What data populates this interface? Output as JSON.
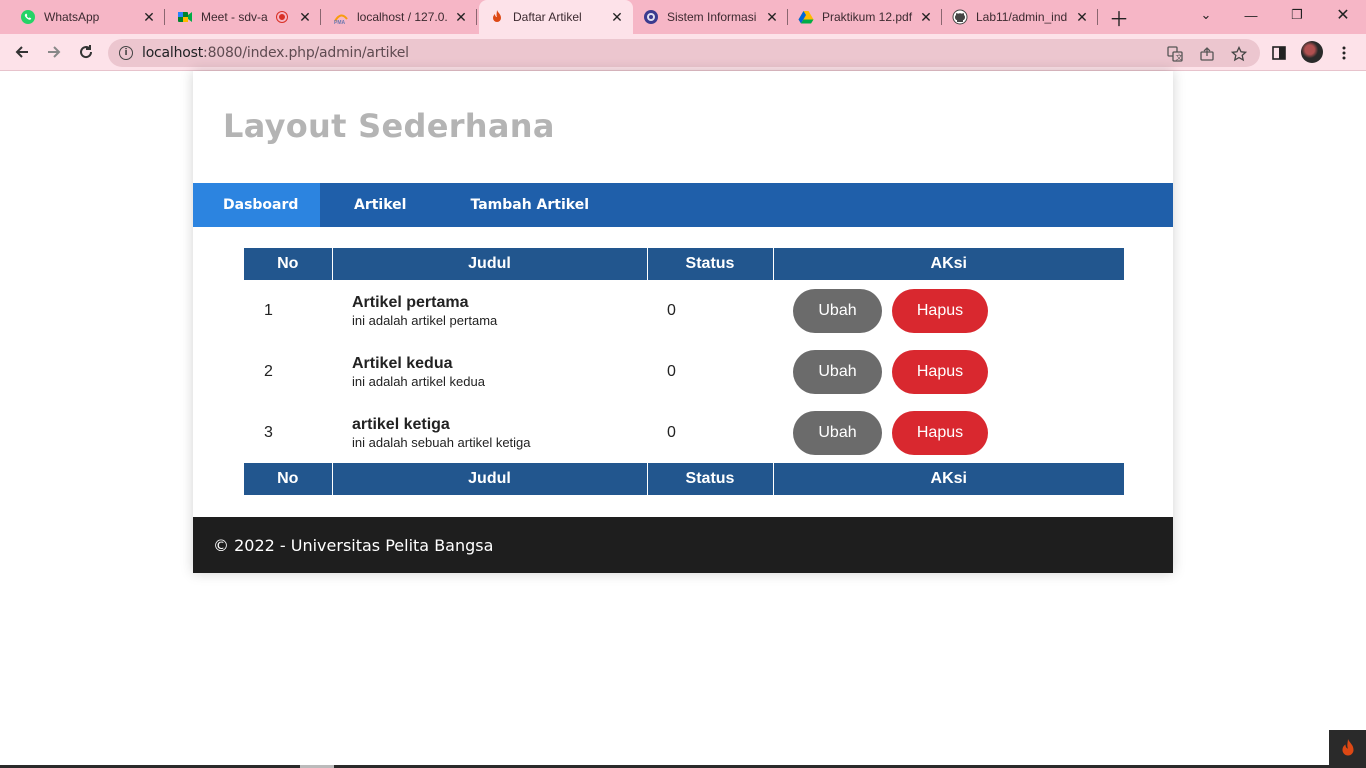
{
  "browser": {
    "tabs": [
      {
        "title": "WhatsApp",
        "icon": "whatsapp-icon"
      },
      {
        "title": "Meet - sdv-a",
        "icon": "google-meet-icon"
      },
      {
        "title": "localhost / 127.0.",
        "icon": "phpmyadmin-icon"
      },
      {
        "title": "Daftar Artikel",
        "icon": "codeigniter-icon"
      },
      {
        "title": "Sistem Informasi",
        "icon": "university-icon"
      },
      {
        "title": "Praktikum 12.pdf",
        "icon": "google-drive-icon"
      },
      {
        "title": "Lab11/admin_ind",
        "icon": "github-icon"
      }
    ],
    "url_host": "localhost",
    "url_rest": ":8080/index.php/admin/artikel",
    "tab_bar_color": "#f6b6c6",
    "toolbar_color": "#fde2e9"
  },
  "page": {
    "site_title": "Layout Sederhana",
    "nav": [
      {
        "label": "Dasboard"
      },
      {
        "label": "Artikel"
      },
      {
        "label": "Tambah Artikel"
      }
    ],
    "table": {
      "headers": [
        "No",
        "Judul",
        "Status",
        "AKsi"
      ],
      "rows": [
        {
          "no": "1",
          "title": "Artikel pertama",
          "desc": "ini adalah artikel pertama",
          "status": "0"
        },
        {
          "no": "2",
          "title": "Artikel kedua",
          "desc": "ini adalah artikel kedua",
          "status": "0"
        },
        {
          "no": "3",
          "title": "artikel ketiga",
          "desc": "ini adalah sebuah artikel ketiga",
          "status": "0"
        }
      ],
      "edit_label": "Ubah",
      "delete_label": "Hapus"
    },
    "footer": "© 2022 - Universitas Pelita Bangsa",
    "colors": {
      "nav": "#1f5faa",
      "nav_active": "#2c84e0",
      "table_header": "#22568e",
      "edit_button": "#6b6b6b",
      "delete_button": "#d9282f",
      "footer": "#1e1e1e"
    }
  }
}
